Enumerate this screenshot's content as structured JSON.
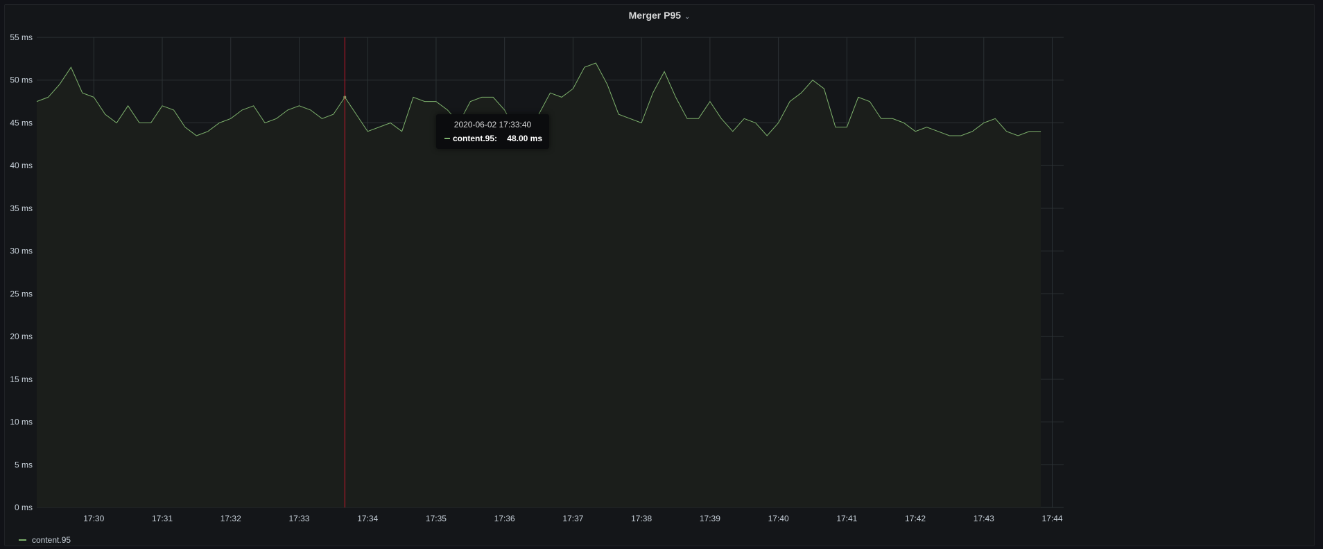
{
  "panel": {
    "title": "Merger P95",
    "title_caret_icon": "chevron-down-icon",
    "legend": [
      {
        "label": "content.95",
        "color": "#7eb26d"
      }
    ],
    "tooltip": {
      "time": "2020-06-02 17:33:40",
      "series": "content.95:",
      "value": "48.00 ms"
    }
  },
  "chart_data": {
    "type": "area",
    "title": "Merger P95",
    "xlabel": "",
    "ylabel": "",
    "x_ticks": [
      "17:30",
      "17:31",
      "17:32",
      "17:33",
      "17:34",
      "17:35",
      "17:36",
      "17:37",
      "17:38",
      "17:39",
      "17:40",
      "17:41",
      "17:42",
      "17:43",
      "17:44"
    ],
    "y_ticks": [
      "0 ms",
      "5 ms",
      "10 ms",
      "15 ms",
      "20 ms",
      "25 ms",
      "30 ms",
      "35 ms",
      "40 ms",
      "45 ms",
      "50 ms",
      "55 ms"
    ],
    "ylim": [
      0,
      55
    ],
    "xlim": [
      "17:29:10",
      "17:44:10"
    ],
    "grid": true,
    "legend_position": "bottom-left",
    "cursor_time": "17:33:40",
    "colors": {
      "line": "#7eb26d",
      "fill": "#1b1e1b",
      "cursor": "#c4162a",
      "grid": "#2c3235",
      "tick_text": "#c7d0d9"
    },
    "series": [
      {
        "name": "content.95",
        "x": [
          "17:29:10",
          "17:29:20",
          "17:29:30",
          "17:29:40",
          "17:29:50",
          "17:30:00",
          "17:30:10",
          "17:30:20",
          "17:30:30",
          "17:30:40",
          "17:30:50",
          "17:31:00",
          "17:31:10",
          "17:31:20",
          "17:31:30",
          "17:31:40",
          "17:31:50",
          "17:32:00",
          "17:32:10",
          "17:32:20",
          "17:32:30",
          "17:32:40",
          "17:32:50",
          "17:33:00",
          "17:33:10",
          "17:33:20",
          "17:33:30",
          "17:33:40",
          "17:33:50",
          "17:34:00",
          "17:34:10",
          "17:34:20",
          "17:34:30",
          "17:34:40",
          "17:34:50",
          "17:35:00",
          "17:35:10",
          "17:35:20",
          "17:35:30",
          "17:35:40",
          "17:35:50",
          "17:36:00",
          "17:36:10",
          "17:36:20",
          "17:36:30",
          "17:36:40",
          "17:36:50",
          "17:37:00",
          "17:37:10",
          "17:37:20",
          "17:37:30",
          "17:37:40",
          "17:37:50",
          "17:38:00",
          "17:38:10",
          "17:38:20",
          "17:38:30",
          "17:38:40",
          "17:38:50",
          "17:39:00",
          "17:39:10",
          "17:39:20",
          "17:39:30",
          "17:39:40",
          "17:39:50",
          "17:40:00",
          "17:40:10",
          "17:40:20",
          "17:40:30",
          "17:40:40",
          "17:40:50",
          "17:41:00",
          "17:41:10",
          "17:41:20",
          "17:41:30",
          "17:41:40",
          "17:41:50",
          "17:42:00",
          "17:42:10",
          "17:42:20",
          "17:42:30",
          "17:42:40",
          "17:42:50",
          "17:43:00",
          "17:43:10",
          "17:43:20",
          "17:43:30",
          "17:43:40",
          "17:43:50"
        ],
        "values": [
          47.5,
          48,
          49.5,
          51.5,
          48.5,
          48,
          46,
          45,
          47,
          45,
          45,
          47,
          46.5,
          44.5,
          43.5,
          44,
          45,
          45.5,
          46.5,
          47,
          45,
          45.5,
          46.5,
          47,
          46.5,
          45.5,
          46,
          48,
          46,
          44,
          44.5,
          45,
          44,
          48,
          47.5,
          47.5,
          46.5,
          45,
          47.5,
          48,
          48,
          46.5,
          44,
          43.5,
          46,
          48.5,
          48,
          49,
          51.5,
          52,
          49.5,
          46,
          45.5,
          45,
          48.5,
          51,
          48,
          45.5,
          45.5,
          47.5,
          45.5,
          44,
          45.5,
          45,
          43.5,
          45,
          47.5,
          48.5,
          50,
          49,
          44.5,
          44.5,
          48,
          47.5,
          45.5,
          45.5,
          45,
          44,
          44.5,
          44,
          43.5,
          43.5,
          44,
          45,
          45.5,
          44,
          43.5,
          44,
          44
        ]
      }
    ]
  }
}
